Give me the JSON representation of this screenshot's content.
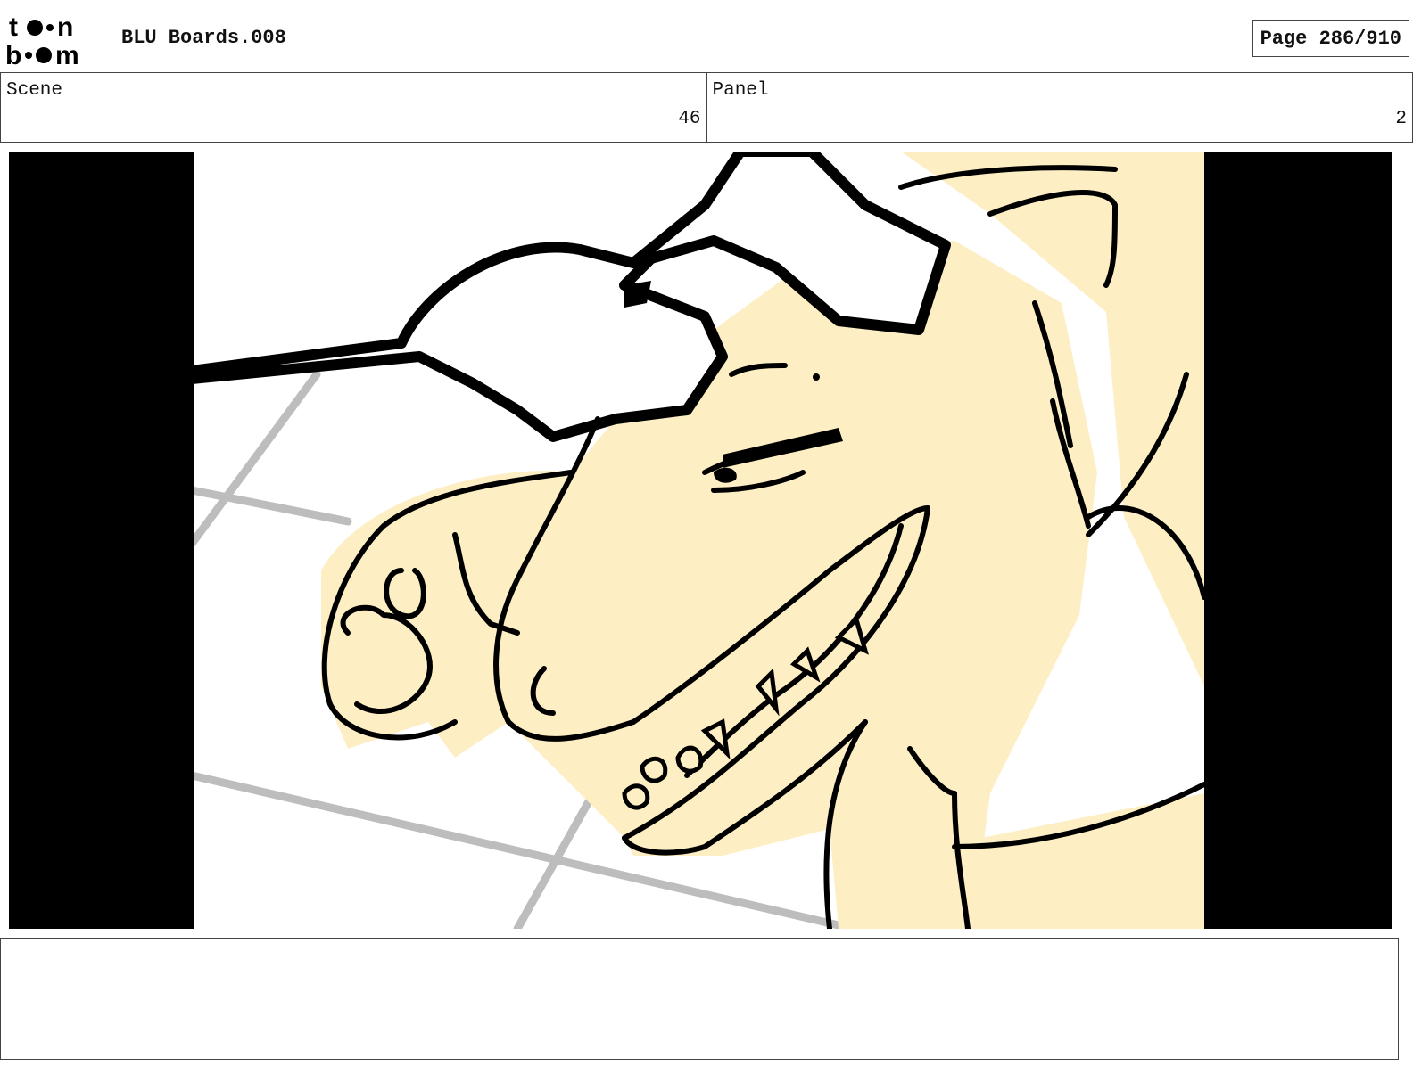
{
  "header": {
    "logo_top": "to•n",
    "logo_bottom": "b••m",
    "title": "BLU Boards.008",
    "page": "Page 286/910"
  },
  "info": {
    "scene_label": "Scene",
    "scene_value": "46",
    "panel_label": "Panel",
    "panel_value": "2"
  },
  "colors": {
    "skin": "#fdeec4",
    "ink": "#000000",
    "floor_line": "#bdbdbd",
    "letterbox": "#000000"
  },
  "notes": {
    "text": ""
  }
}
